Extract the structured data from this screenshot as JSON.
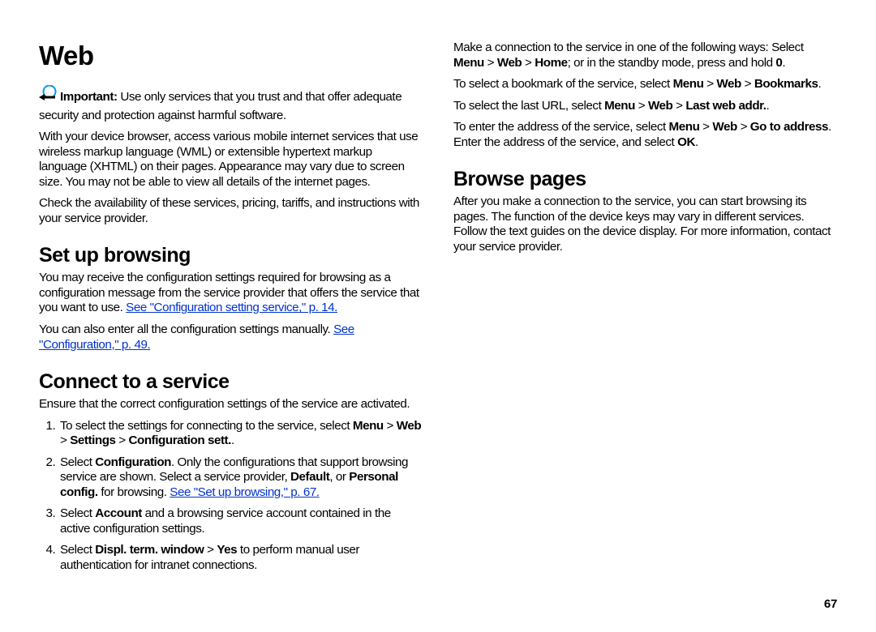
{
  "page_number": "67",
  "title": "Web",
  "intro": {
    "important_label": "Important:",
    "important_text": "  Use only services that you trust and that offer adequate security and protection against harmful software.",
    "p2": "With your device browser, access various mobile internet services that use wireless markup language (WML) or extensible hypertext markup language (XHTML) on their pages. Appearance may vary due to screen size. You may not be able to view all details of the internet pages.",
    "p3": "Check the availability of these services, pricing, tariffs, and instructions with your service provider."
  },
  "setup": {
    "heading": "Set up browsing",
    "p1a": "You may receive the configuration settings required for browsing as a configuration message from the service provider that offers the service that you want to use. ",
    "link1": "See \"Configuration setting service,\" p. 14.",
    "p2a": "You can also enter all the configuration settings manually. ",
    "link2": "See \"Configuration,\" p. 49."
  },
  "connect": {
    "heading": "Connect to a service",
    "p1": "Ensure that the correct configuration settings of the service are activated.",
    "li1_a": "To select the settings for connecting to the service, select ",
    "li1_b": "Menu",
    "li1_c": " > ",
    "li1_d": "Web",
    "li1_e": " > ",
    "li1_f": "Settings",
    "li1_g": " > ",
    "li1_h": "Configuration sett.",
    "li1_i": ".",
    "li2_a": "Select ",
    "li2_b": "Configuration",
    "li2_c": ". Only the configurations that support browsing service are shown. Select a service provider, ",
    "li2_d": "Default",
    "li2_e": ", or ",
    "li2_f": "Personal config.",
    "li2_g": " for browsing. ",
    "li2_link": "See \"Set up browsing,\" p. 67.",
    "li3_a": "Select ",
    "li3_b": "Account",
    "li3_c": " and a browsing service account contained in the active configuration settings.",
    "li4_a": "Select ",
    "li4_b": "Displ. term. window",
    "li4_c": " > ",
    "li4_d": "Yes",
    "li4_e": " to perform manual user authentication for intranet connections.",
    "after1_a": "Make a connection to the service in one of the following ways: Select ",
    "after1_b": "Menu",
    "after1_c": " > ",
    "after1_d": "Web",
    "after1_e": " > ",
    "after1_f": "Home",
    "after1_g": "; or in the standby mode, press and hold ",
    "after1_h": "0",
    "after1_i": ".",
    "after2_a": "To select a bookmark of the service, select ",
    "after2_b": "Menu",
    "after2_c": " > ",
    "after2_d": "Web",
    "after2_e": " > ",
    "after2_f": "Bookmarks",
    "after2_g": ".",
    "after3_a": "To select the last URL, select ",
    "after3_b": "Menu",
    "after3_c": " > ",
    "after3_d": "Web",
    "after3_e": " > ",
    "after3_f": "Last web addr.",
    "after3_g": ".",
    "after4_a": "To enter the address of the service, select ",
    "after4_b": "Menu",
    "after4_c": " > ",
    "after4_d": "Web",
    "after4_e": " > ",
    "after4_f": "Go to address",
    "after4_g": ". Enter the address of the service, and select ",
    "after4_h": "OK",
    "after4_i": "."
  },
  "browse": {
    "heading": "Browse pages",
    "p1": "After you make a connection to the service, you can start browsing its pages. The function of the device keys may vary in different services. Follow the text guides on the device display. For more information, contact your service provider."
  }
}
